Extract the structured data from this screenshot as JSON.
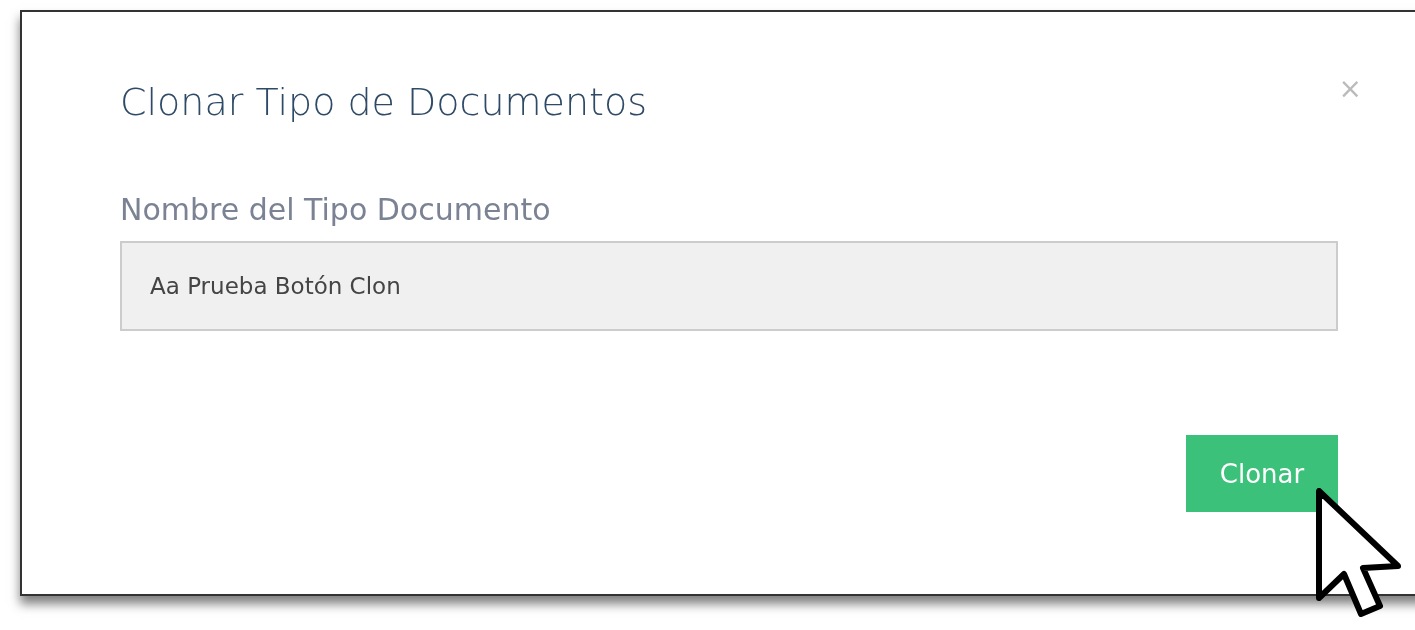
{
  "dialog": {
    "title": "Clonar Tipo de Documentos",
    "close": "×"
  },
  "field": {
    "label": "Nombre del Tipo Documento",
    "value": "Aa Prueba Botón Clon"
  },
  "buttons": [
    {
      "label": "Clonar",
      "kind": "primary"
    }
  ]
}
